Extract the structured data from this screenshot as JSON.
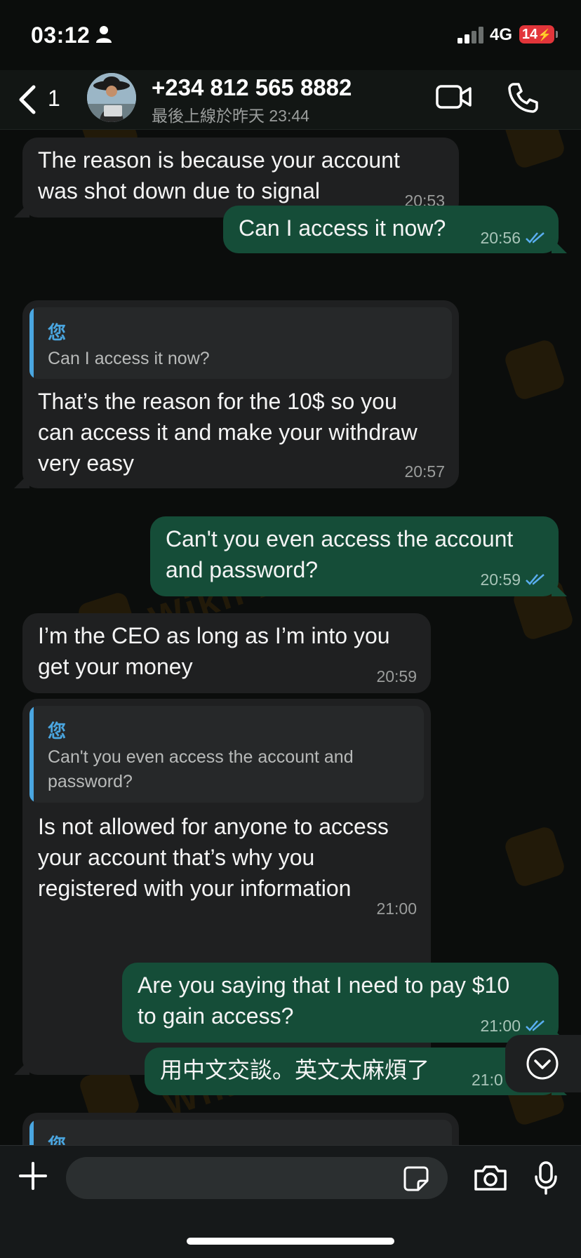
{
  "status": {
    "time": "03:12",
    "network": "4G",
    "battery": "14"
  },
  "header": {
    "back_count": "1",
    "contact_name": "+234 812 565 8882",
    "last_seen": "最後上線於昨天 23:44"
  },
  "colors": {
    "incoming": "#1f2021",
    "outgoing": "#154d38",
    "quote_accent": "#4aa6e0",
    "read_ticks": "#5aaef0"
  },
  "messages": [
    {
      "dir": "in",
      "text": "The reason is because your account\nwas shot down due to signal",
      "time": "20:53"
    },
    {
      "dir": "out",
      "text": "Can I access it now?",
      "time": "20:56",
      "read": true
    },
    {
      "dir": "in",
      "quote_author": "您",
      "quote_text": "Can I access it now?",
      "text": "That’s the reason for the 10$ so you\ncan access it and make your withdraw\nvery easy",
      "time": "20:57"
    },
    {
      "dir": "out",
      "text": "Can't you even access the account\nand password?",
      "time": "20:59",
      "read": true
    },
    {
      "dir": "in",
      "text": "I’m the CEO as long as I’m into you\nget your money",
      "time": "20:59"
    },
    {
      "dir": "in",
      "quote_author": "您",
      "quote_text": "Can't you even access the account and\npassword?",
      "text": "Is not allowed for anyone to access\nyour account that’s why you\nregistered with your information",
      "time": "21:00"
    },
    {
      "dir": "out",
      "text": "Are you saying that I need to pay $10\nto gain access?",
      "time": "21:00",
      "read": true
    },
    {
      "dir": "out",
      "text": "用中文交談。英文太麻煩了",
      "time": "21:0",
      "read": true
    },
    {
      "dir": "in",
      "quote_author": "您"
    }
  ],
  "watermark": "WikiFX",
  "input": {
    "placeholder": ""
  },
  "icons": {
    "back": "chevron-left-icon",
    "video": "video-camera-icon",
    "call": "phone-icon",
    "scroll": "chevron-down-circle-icon",
    "plus": "plus-icon",
    "sticker": "sticker-icon",
    "camera": "camera-icon",
    "mic": "microphone-icon"
  }
}
